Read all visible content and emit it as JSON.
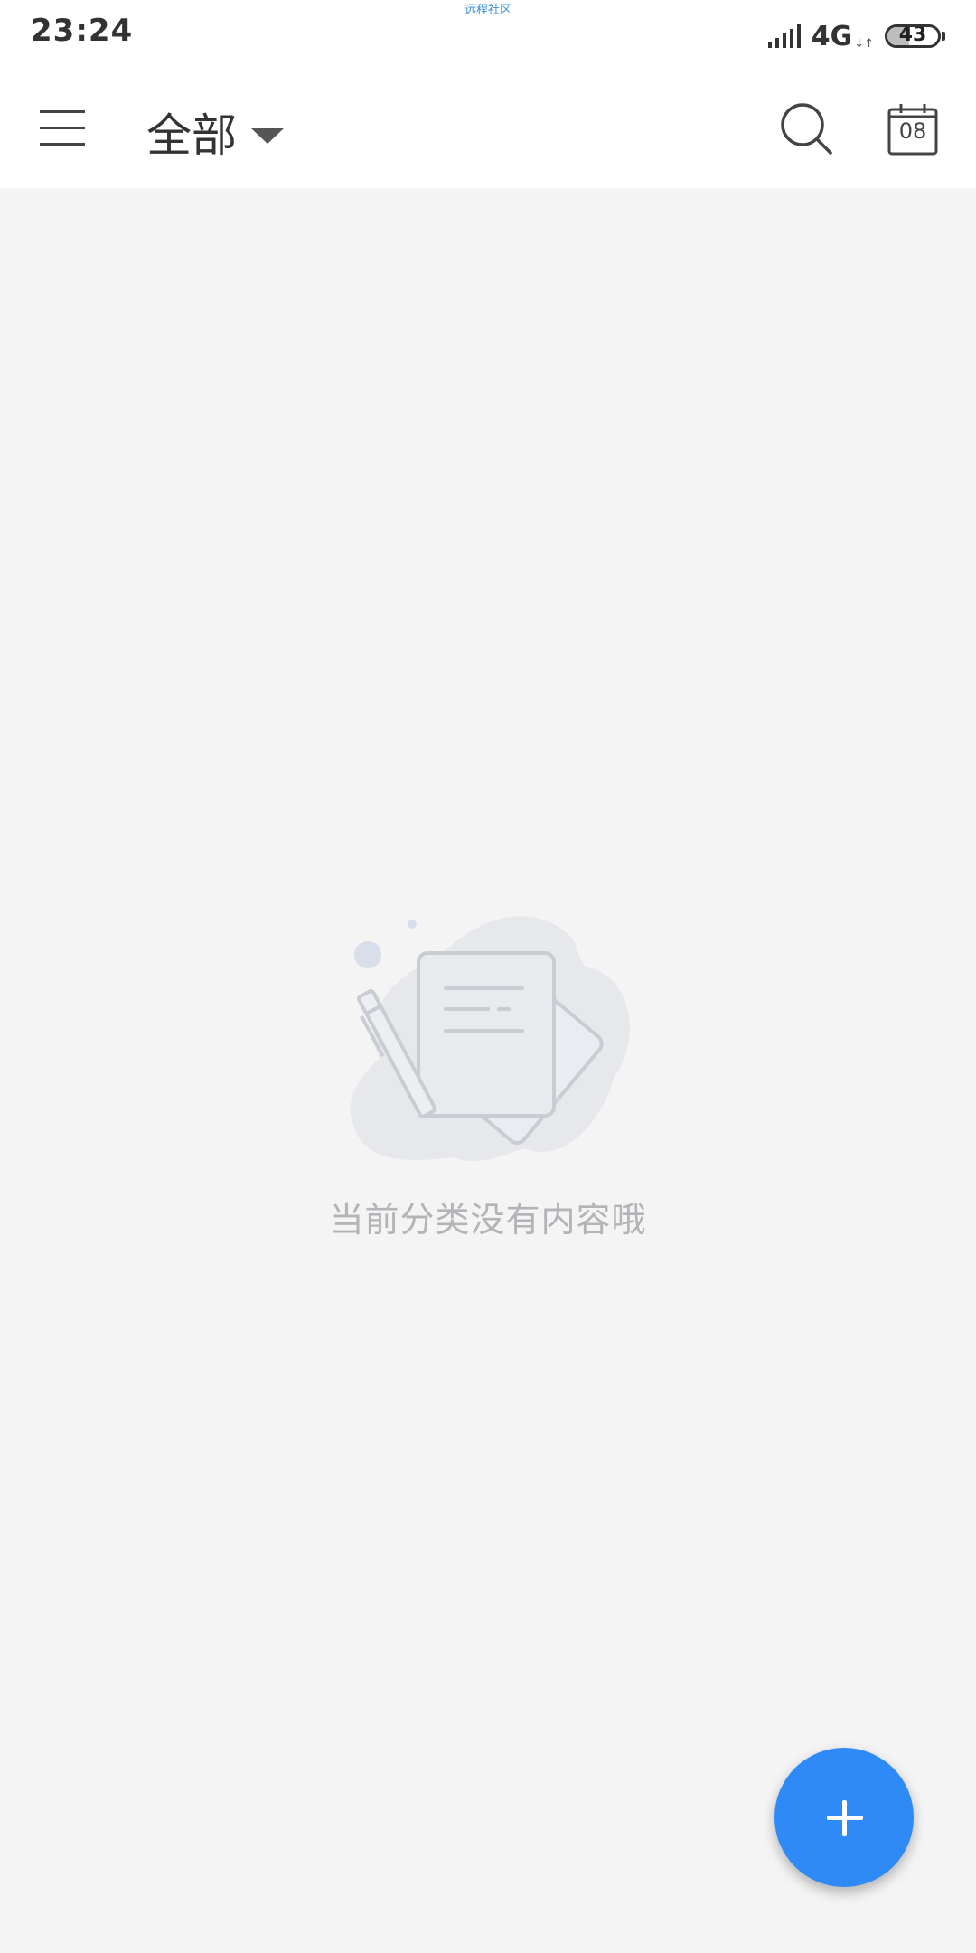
{
  "status_bar": {
    "time": "23:24",
    "center_label": "远程社区",
    "network": "4G",
    "network_activity": "↓↑",
    "battery_percent": "43",
    "battery_level": 0.43
  },
  "app_bar": {
    "category_label": "全部",
    "menu_icon": "hamburger-menu-icon",
    "search_icon": "search-icon",
    "calendar_icon": "calendar-icon",
    "calendar_day": "08"
  },
  "empty_state": {
    "message": "当前分类没有内容哦",
    "illustration": "empty-notes-illustration"
  },
  "fab": {
    "icon": "plus-icon"
  },
  "colors": {
    "background": "#f4f4f4",
    "app_bar": "#ffffff",
    "accent": "#2e8af7",
    "empty_text": "#b3b3b8"
  }
}
